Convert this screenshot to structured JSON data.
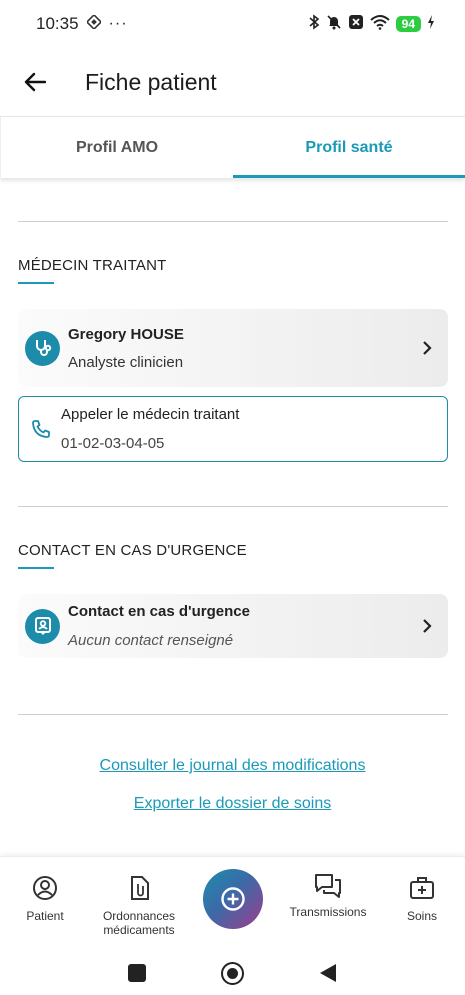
{
  "status_bar": {
    "time": "10:35",
    "battery": "94"
  },
  "header": {
    "title": "Fiche patient"
  },
  "tabs": [
    {
      "label": "Profil AMO",
      "active": false
    },
    {
      "label": "Profil santé",
      "active": true
    }
  ],
  "medecin_section": {
    "title": "MÉDECIN TRAITANT",
    "card": {
      "name": "Gregory HOUSE",
      "role": "Analyste clinicien"
    },
    "call": {
      "label": "Appeler le médecin traitant",
      "phone": "01-02-03-04-05"
    }
  },
  "contact_section": {
    "title": "CONTACT EN CAS D'URGENCE",
    "card": {
      "name": "Contact en cas d'urgence",
      "status": "Aucun contact renseigné"
    }
  },
  "links": {
    "journal": "Consulter le journal des modifications",
    "export": "Exporter le dossier de soins"
  },
  "bottom_nav": {
    "patient": "Patient",
    "ordonnances_line1": "Ordonnances",
    "ordonnances_line2": "médicaments",
    "transmissions": "Transmissions",
    "soins": "Soins"
  },
  "colors": {
    "accent": "#1a9ab8",
    "icon_bg": "#1d8cab"
  }
}
